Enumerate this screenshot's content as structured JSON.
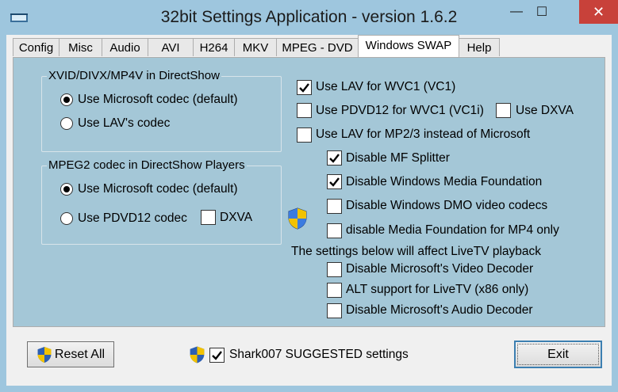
{
  "window": {
    "title": "32bit Settings Application - version 1.6.2",
    "controls": {
      "minimize": "—",
      "maximize": "☐",
      "close": "✕"
    },
    "colors": {
      "background": "#9ec6de",
      "close": "#c8413a",
      "pane": "#a4c7d7"
    }
  },
  "tabs": [
    {
      "label": "Config"
    },
    {
      "label": "Misc"
    },
    {
      "label": "Audio"
    },
    {
      "label": "AVI"
    },
    {
      "label": "H264"
    },
    {
      "label": "MKV"
    },
    {
      "label": "MPEG - DVD"
    },
    {
      "label": "Windows SWAP",
      "active": true
    },
    {
      "label": "Help"
    }
  ],
  "xvid_group": {
    "title": "XVID/DIVX/MP4V in DirectShow",
    "options": [
      {
        "label": "Use Microsoft codec (default)",
        "selected": true
      },
      {
        "label": "Use LAV's codec",
        "selected": false
      }
    ]
  },
  "mpeg2_group": {
    "title": "MPEG2 codec in DirectShow Players",
    "options": [
      {
        "label": "Use Microsoft codec (default)",
        "selected": true
      },
      {
        "label": "Use PDVD12 codec",
        "selected": false
      }
    ],
    "dxva_label": "DXVA",
    "dxva_checked": false
  },
  "right": {
    "use_lav_wvc1": {
      "label": "Use LAV for WVC1 (VC1)",
      "checked": true
    },
    "use_pdvd_wvc1": {
      "label": "Use PDVD12 for WVC1 (VC1i)",
      "checked": false
    },
    "use_dxva": {
      "label": "Use DXVA",
      "checked": false
    },
    "use_lav_mp23": {
      "label": "Use LAV for MP2/3 instead of Microsoft",
      "checked": false
    },
    "disable_mf_splitter": {
      "label": "Disable MF Splitter",
      "checked": true
    },
    "disable_wmf": {
      "label": "Disable Windows Media Foundation",
      "checked": true
    },
    "disable_dmo": {
      "label": "Disable Windows DMO video codecs",
      "checked": false
    },
    "disable_mf_mp4": {
      "label": "disable Media Foundation for MP4 only",
      "checked": false
    },
    "livetv_note": "The settings below will affect LiveTV playback",
    "disable_ms_video": {
      "label": "Disable Microsoft's Video Decoder",
      "checked": false
    },
    "alt_support": {
      "label": "ALT support for LiveTV (x86 only)",
      "checked": false
    },
    "disable_ms_audio": {
      "label": "Disable Microsoft's Audio Decoder",
      "checked": false
    }
  },
  "bottom": {
    "reset_label": "Reset All",
    "suggested_label": "Shark007 SUGGESTED settings",
    "suggested_checked": true,
    "exit_label": "Exit"
  }
}
